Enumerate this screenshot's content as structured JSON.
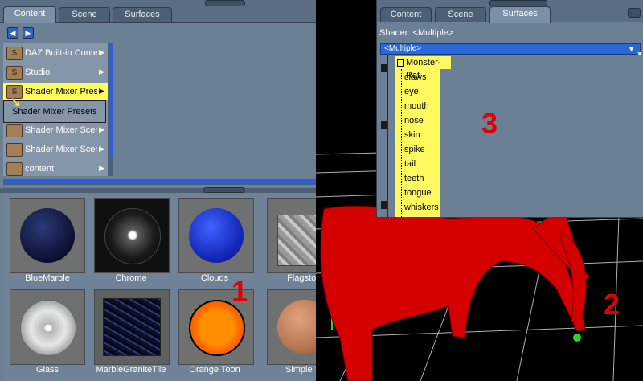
{
  "left_panel": {
    "tabs": [
      "Content",
      "Scene",
      "Surfaces"
    ],
    "tree": [
      {
        "label": "DAZ Built-in Conte",
        "has_arrow": true
      },
      {
        "label": "Studio",
        "has_arrow": true
      },
      {
        "label": "Shader Mixer Preset",
        "has_arrow": true,
        "selected": true
      },
      {
        "label": "Shader Mixer Scene",
        "has_arrow": true
      },
      {
        "label": "Shader Mixer Scene",
        "has_arrow": true
      },
      {
        "label": "content",
        "has_arrow": true
      }
    ],
    "tooltip": "Shader Mixer Presets",
    "thumbnails": [
      {
        "label": "BlueMarble",
        "icon": "sphere-dark-blue"
      },
      {
        "label": "Chrome",
        "icon": "sphere-chrome"
      },
      {
        "label": "Clouds",
        "icon": "sphere-blue"
      },
      {
        "label": "Flagstor",
        "icon": "cube-stone"
      },
      {
        "label": "Glass",
        "icon": "sphere-glass"
      },
      {
        "label": "MarbleGraniteTile",
        "icon": "cube-granite"
      },
      {
        "label": "Orange Toon",
        "icon": "sphere-orange"
      },
      {
        "label": "Simple S",
        "icon": "sphere-skin"
      }
    ],
    "marker": "1"
  },
  "viewport": {
    "marker": "2"
  },
  "surfaces_panel": {
    "tabs": [
      "Content",
      "Scene",
      "Surfaces"
    ],
    "shader_label": "Shader: <Multiple>",
    "dropdown_value": "<Multiple>",
    "root": "Monster-Rat",
    "items": [
      "claws",
      "eye",
      "mouth",
      "nose",
      "skin",
      "spike",
      "tail",
      "teeth",
      "tongue",
      "whiskers"
    ],
    "marker": "3"
  }
}
